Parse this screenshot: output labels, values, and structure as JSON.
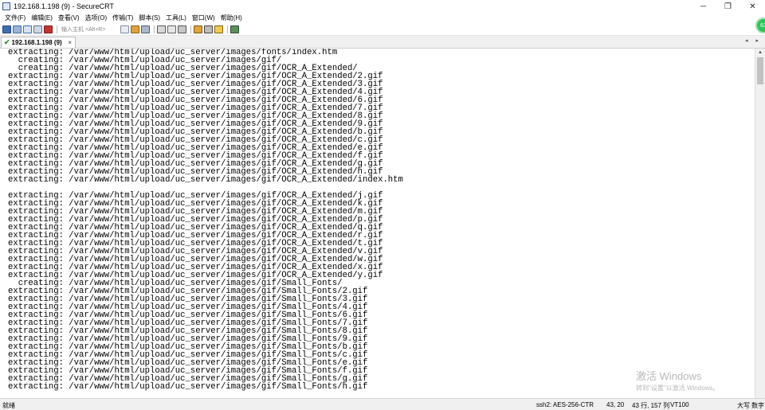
{
  "window": {
    "title": "192.168.1.198 (9) - SecureCRT",
    "controls": [
      "─",
      "❐",
      "✕"
    ]
  },
  "menu": [
    "文件(F)",
    "编辑(E)",
    "查看(V)",
    "选项(O)",
    "传输(T)",
    "脚本(S)",
    "工具(L)",
    "窗口(W)",
    "帮助(H)"
  ],
  "toolbar": {
    "quick_connect_placeholder": "输入主机 <Alt+R>",
    "icons": [
      "connect-icon",
      "quick-connect-icon",
      "connect-tab-icon",
      "reconnect-icon",
      "disconnect-icon",
      "copy-icon",
      "paste-icon",
      "find-icon",
      "print-icon",
      "print-setup-icon",
      "session-options-icon",
      "sftp-icon",
      "keymap-icon",
      "help-icon",
      "script-icon"
    ],
    "colors": {
      "connect": "#3b6db3",
      "disconnect": "#c8322d",
      "accent": "#e0a23a"
    }
  },
  "tab": {
    "label": "192.168.1.198 (9)",
    "close": "×",
    "status_color": "#1e9a2e"
  },
  "nav_arrows": "◂ ▸",
  "badge": "63",
  "terminal": {
    "lines": [
      "extracting: /var/www/html/upload/uc_server/images/fonts/index.htm",
      "  creating: /var/www/html/upload/uc_server/images/gif/",
      "  creating: /var/www/html/upload/uc_server/images/gif/OCR_A_Extended/",
      "extracting: /var/www/html/upload/uc_server/images/gif/OCR_A_Extended/2.gif",
      "extracting: /var/www/html/upload/uc_server/images/gif/OCR_A_Extended/3.gif",
      "extracting: /var/www/html/upload/uc_server/images/gif/OCR_A_Extended/4.gif",
      "extracting: /var/www/html/upload/uc_server/images/gif/OCR_A_Extended/6.gif",
      "extracting: /var/www/html/upload/uc_server/images/gif/OCR_A_Extended/7.gif",
      "extracting: /var/www/html/upload/uc_server/images/gif/OCR_A_Extended/8.gif",
      "extracting: /var/www/html/upload/uc_server/images/gif/OCR_A_Extended/9.gif",
      "extracting: /var/www/html/upload/uc_server/images/gif/OCR_A_Extended/b.gif",
      "extracting: /var/www/html/upload/uc_server/images/gif/OCR_A_Extended/c.gif",
      "extracting: /var/www/html/upload/uc_server/images/gif/OCR_A_Extended/e.gif",
      "extracting: /var/www/html/upload/uc_server/images/gif/OCR_A_Extended/f.gif",
      "extracting: /var/www/html/upload/uc_server/images/gif/OCR_A_Extended/g.gif",
      "extracting: /var/www/html/upload/uc_server/images/gif/OCR_A_Extended/h.gif",
      "extracting: /var/www/html/upload/uc_server/images/gif/OCR_A_Extended/index.htm",
      "",
      "extracting: /var/www/html/upload/uc_server/images/gif/OCR_A_Extended/j.gif",
      "extracting: /var/www/html/upload/uc_server/images/gif/OCR_A_Extended/k.gif",
      "extracting: /var/www/html/upload/uc_server/images/gif/OCR_A_Extended/m.gif",
      "extracting: /var/www/html/upload/uc_server/images/gif/OCR_A_Extended/p.gif",
      "extracting: /var/www/html/upload/uc_server/images/gif/OCR_A_Extended/q.gif",
      "extracting: /var/www/html/upload/uc_server/images/gif/OCR_A_Extended/r.gif",
      "extracting: /var/www/html/upload/uc_server/images/gif/OCR_A_Extended/t.gif",
      "extracting: /var/www/html/upload/uc_server/images/gif/OCR_A_Extended/v.gif",
      "extracting: /var/www/html/upload/uc_server/images/gif/OCR_A_Extended/w.gif",
      "extracting: /var/www/html/upload/uc_server/images/gif/OCR_A_Extended/x.gif",
      "extracting: /var/www/html/upload/uc_server/images/gif/OCR_A_Extended/y.gif",
      "  creating: /var/www/html/upload/uc_server/images/gif/Small_Fonts/",
      "extracting: /var/www/html/upload/uc_server/images/gif/Small_Fonts/2.gif",
      "extracting: /var/www/html/upload/uc_server/images/gif/Small_Fonts/3.gif",
      "extracting: /var/www/html/upload/uc_server/images/gif/Small_Fonts/4.gif",
      "extracting: /var/www/html/upload/uc_server/images/gif/Small_Fonts/6.gif",
      "extracting: /var/www/html/upload/uc_server/images/gif/Small_Fonts/7.gif",
      "extracting: /var/www/html/upload/uc_server/images/gif/Small_Fonts/8.gif",
      "extracting: /var/www/html/upload/uc_server/images/gif/Small_Fonts/9.gif",
      "extracting: /var/www/html/upload/uc_server/images/gif/Small_Fonts/b.gif",
      "extracting: /var/www/html/upload/uc_server/images/gif/Small_Fonts/c.gif",
      "extracting: /var/www/html/upload/uc_server/images/gif/Small_Fonts/e.gif",
      "extracting: /var/www/html/upload/uc_server/images/gif/Small_Fonts/f.gif",
      "extracting: /var/www/html/upload/uc_server/images/gif/Small_Fonts/g.gif",
      "extracting: /var/www/html/upload/uc_server/images/gif/Small_Fonts/h.gif"
    ]
  },
  "watermark": {
    "title": "激活 Windows",
    "subtitle": "转到\"设置\"以激活 Windows。"
  },
  "status": {
    "ready": "就绪",
    "protocol": "ssh2: AES-256-CTR",
    "cursor": "43, 20",
    "size": "43 行, 157 列",
    "terminal": "VT100",
    "caps": "大写",
    "num": "数字"
  }
}
